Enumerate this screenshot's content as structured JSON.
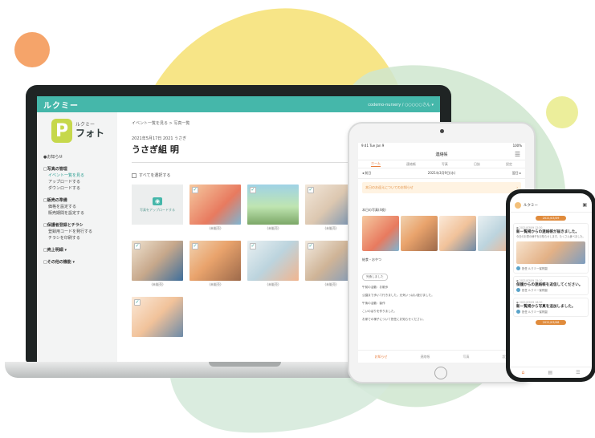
{
  "colors": {
    "accent_teal": "#45b7aa",
    "accent_orange": "#e87c3b",
    "logo_green": "#c6d84b",
    "blob_yellow": "#f6e27a",
    "blob_mint": "#cfe6cf"
  },
  "laptop": {
    "topbar": {
      "brand": "ルクミー",
      "user": "codemo-nursery / ○○○○○さん ▾"
    },
    "logo": {
      "mark": "P",
      "small": "ルクミー",
      "big": "フォト"
    },
    "sidebar": [
      {
        "type": "item",
        "label": "●お知らせ",
        "active": false
      },
      {
        "type": "head",
        "label": "□写真の管理"
      },
      {
        "type": "item",
        "label": "イベント一覧を見る",
        "active": true,
        "indent": true
      },
      {
        "type": "item",
        "label": "アップロードする",
        "active": false,
        "indent": true
      },
      {
        "type": "item",
        "label": "ダウンロードする",
        "active": false,
        "indent": true
      },
      {
        "type": "head",
        "label": "□販売の準備"
      },
      {
        "type": "item",
        "label": "価格を設定する",
        "active": false,
        "indent": true
      },
      {
        "type": "item",
        "label": "販売期間を設定する",
        "active": false,
        "indent": true
      },
      {
        "type": "head",
        "label": "□保護者登録とチラシ"
      },
      {
        "type": "item",
        "label": "登録用コードを発行する",
        "active": false,
        "indent": true
      },
      {
        "type": "item",
        "label": "チラシを印刷する",
        "active": false,
        "indent": true
      },
      {
        "type": "head",
        "label": "□売上明細 ▾"
      },
      {
        "type": "head",
        "label": "□その他の機能 ▾"
      }
    ],
    "main": {
      "breadcrumb": "イベント一覧を見る > 写真一覧",
      "date_line": "2021年5月17日  2021 うさぎ",
      "title": "うさぎ組 明",
      "select_all": "すべてを選択する",
      "upload_label": "写真をアップロードする",
      "photos": [
        {
          "caption": "(未販売)"
        },
        {
          "caption": "(未販売)"
        },
        {
          "caption": "(未販売)"
        },
        {
          "caption": "(未販売)"
        },
        {
          "caption": "(未販売)"
        },
        {
          "caption": "(未販売)"
        },
        {
          "caption": "(未販売)"
        },
        {
          "caption": ""
        }
      ]
    }
  },
  "tablet": {
    "status_left": "9:41  Tue Jan 9",
    "status_right": "100%",
    "header": "連絡帳",
    "tabs": [
      "ホーム",
      "連絡帳",
      "写真",
      "日誌",
      "設定"
    ],
    "date": "2021年3月9日(水)",
    "date_next": "翌日 ▸",
    "date_prev": "◂ 前日",
    "notice": "本日のお迎えについてのお知らせ",
    "section_photos": "本日の写真(4枚)",
    "section_meal": "給食・おやつ",
    "pill": "完食しました",
    "texts": [
      "午前の活動：お散歩",
      "公園まで歩いて行きました。元気いっぱい遊びました。",
      "午後の活動：製作",
      "こいのぼりを作りました。",
      "お家での様子について担任にお知らせください。"
    ],
    "bottom_tabs": [
      "お知らせ",
      "連絡帳",
      "写真",
      "設定"
    ]
  },
  "phone": {
    "header": "ルクミー",
    "date_badge": "2021/03/09",
    "cards": [
      {
        "meta": "● 2021/03/09 12:30",
        "title": "新一覧掲からの連絡帳が届きました。",
        "body": "今日のお昼の様子をお知らせします。たくさん食べました。",
        "author": "担任 ルクミー保育園"
      },
      {
        "meta": "● 2021/03/09 15:10",
        "title": "保護からの連絡帳を返信してください。",
        "body": "",
        "author": "担任 ルクミー保育園"
      },
      {
        "meta": "● 2021/03/09 16:20",
        "title": "新一覧掲から写真を追加しました。",
        "body": "",
        "author": "担任 ルクミー保育園"
      }
    ],
    "date_badge2": "2021/03/08"
  }
}
